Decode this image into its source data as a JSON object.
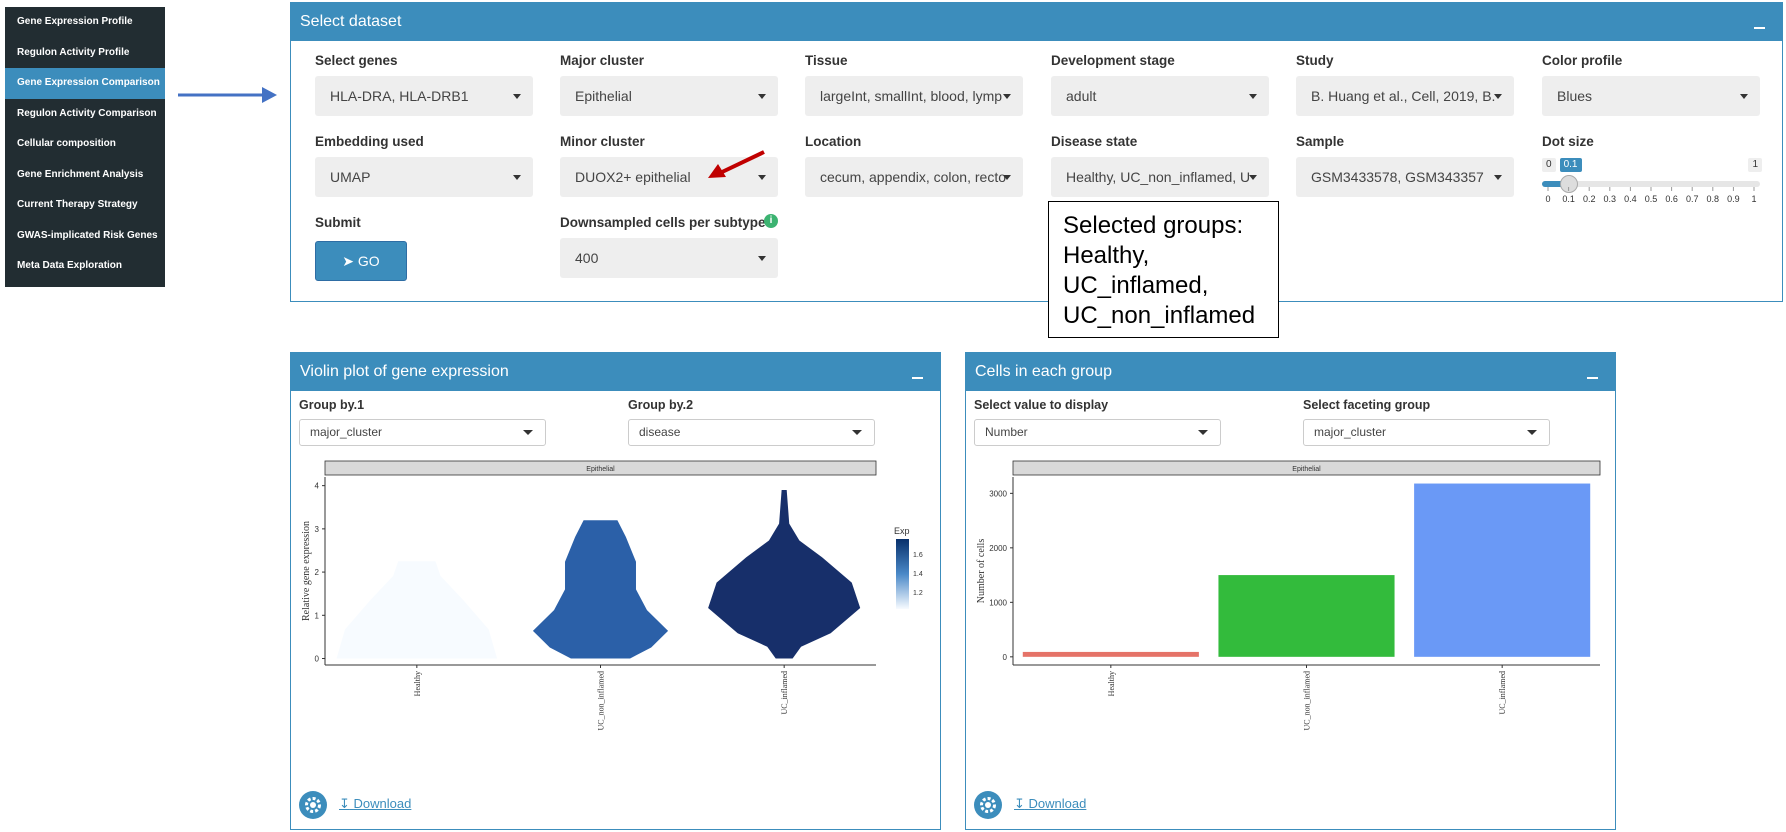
{
  "sidebar": {
    "items": [
      {
        "label": "Gene Expression Profile",
        "active": false
      },
      {
        "label": "Regulon Activity Profile",
        "active": false
      },
      {
        "label": "Gene Expression Comparison",
        "active": true
      },
      {
        "label": "Regulon Activity Comparison",
        "active": false
      },
      {
        "label": "Cellular composition",
        "active": false
      },
      {
        "label": "Gene Enrichment Analysis",
        "active": false
      },
      {
        "label": "Current Therapy Strategy",
        "active": false
      },
      {
        "label": "GWAS-implicated Risk Genes",
        "active": false
      },
      {
        "label": "Meta Data Exploration",
        "active": false
      }
    ]
  },
  "dataset": {
    "title": "Select dataset",
    "select_genes": {
      "label": "Select genes",
      "value": "HLA-DRA, HLA-DRB1"
    },
    "major_cluster": {
      "label": "Major cluster",
      "value": "Epithelial"
    },
    "tissue": {
      "label": "Tissue",
      "value": "largeInt, smallInt, blood, lymp"
    },
    "development_stage": {
      "label": "Development stage",
      "value": "adult"
    },
    "study": {
      "label": "Study",
      "value": "B. Huang et al., Cell, 2019, B."
    },
    "color_profile": {
      "label": "Color profile",
      "value": "Blues"
    },
    "embedding": {
      "label": "Embedding used",
      "value": "UMAP"
    },
    "minor_cluster": {
      "label": "Minor cluster",
      "value": "DUOX2+ epithelial"
    },
    "location": {
      "label": "Location",
      "value": "cecum, appendix, colon, recto"
    },
    "disease_state": {
      "label": "Disease state",
      "value": "Healthy, UC_non_inflamed, U"
    },
    "sample": {
      "label": "Sample",
      "value": "GSM3433578, GSM343357"
    },
    "dot_size": {
      "label": "Dot size",
      "min": "0",
      "max": "1",
      "value": 0.1,
      "value_label": "0.1",
      "ticks": [
        "0",
        "0.1",
        "0.2",
        "0.3",
        "0.4",
        "0.5",
        "0.6",
        "0.7",
        "0.8",
        "0.9",
        "1"
      ]
    },
    "submit": {
      "label": "Submit",
      "button": "GO"
    },
    "downsampled": {
      "label": "Downsampled cells per subtype",
      "value": "400",
      "info": "i"
    }
  },
  "annotation": {
    "lines": [
      "Selected groups:",
      "Healthy,",
      "UC_inflamed,",
      "UC_non_inflamed"
    ]
  },
  "violin_panel": {
    "title": "Violin plot of gene expression",
    "group_by_1": {
      "label": "Group by.1",
      "value": "major_cluster"
    },
    "group_by_2": {
      "label": "Group by.2",
      "value": "disease"
    },
    "download": "Download"
  },
  "cells_panel": {
    "title": "Cells in each group",
    "display_value": {
      "label": "Select value to display",
      "value": "Number"
    },
    "faceting": {
      "label": "Select faceting group",
      "value": "major_cluster"
    },
    "download": "Download"
  },
  "chart_data": [
    {
      "type": "violin",
      "title": "Epithelial",
      "ylabel": "Relative gene expression",
      "categories": [
        "Healthy",
        "UC_non_inflamed",
        "UC_inflamed"
      ],
      "ylim": [
        -0.15,
        4.2
      ],
      "yticks": [
        0,
        1,
        2,
        3,
        4
      ],
      "series": [
        {
          "category": "Healthy",
          "min": 0,
          "max": 2.25,
          "exp": 1.0,
          "color": "#f7fbff"
        },
        {
          "category": "UC_non_inflamed",
          "min": 0,
          "max": 3.2,
          "exp": 1.45,
          "color": "#2b60a8"
        },
        {
          "category": "UC_inflamed",
          "min": 0,
          "max": 3.9,
          "exp": 1.75,
          "color": "#172f6a"
        }
      ],
      "legend": {
        "title": "Exp",
        "ticks": [
          "1.6",
          "1.4",
          "1.2"
        ],
        "position": "right"
      }
    },
    {
      "type": "bar",
      "title": "Epithelial",
      "ylabel": "Number of cells",
      "categories": [
        "Healthy",
        "UC_non_inflamed",
        "UC_inflamed"
      ],
      "values": [
        90,
        1500,
        3180
      ],
      "colors": [
        "#e57368",
        "#33bb3c",
        "#6a99f6"
      ],
      "ylim": [
        -150,
        3300
      ],
      "yticks": [
        "0",
        "1000",
        "2000",
        "3000"
      ]
    }
  ]
}
